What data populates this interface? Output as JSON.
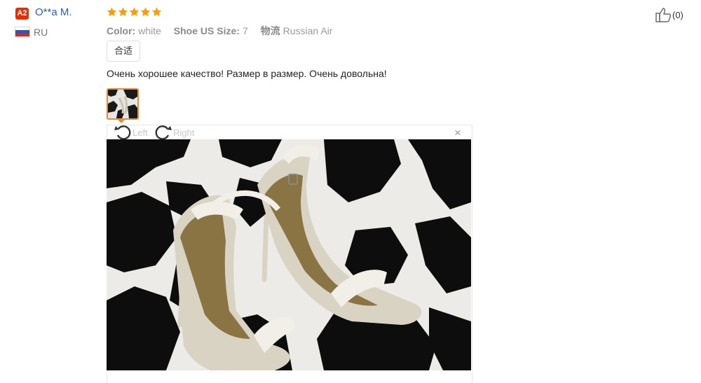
{
  "reviewer": {
    "badge": "A2",
    "name": "O**a M.",
    "country": "RU"
  },
  "rating": {
    "stars": 5,
    "max": 5,
    "color": "#ff9a00"
  },
  "order_info": {
    "color_label": "Color:",
    "color_value": "white",
    "size_label": "Shoe US Size:",
    "size_value": "7",
    "shipping_label": "物流",
    "shipping_value": "Russian Air"
  },
  "tag": "合适",
  "review_text": "Очень хорошее качество! Размер в размер. Очень довольна!",
  "viewer": {
    "rotate_left": "Left",
    "rotate_right": "Right",
    "close": "×"
  },
  "like": {
    "count": "(0)"
  },
  "colors": {
    "accent": "#e48a3a",
    "name": "#2a5fb0",
    "badge": "#e62e04"
  }
}
